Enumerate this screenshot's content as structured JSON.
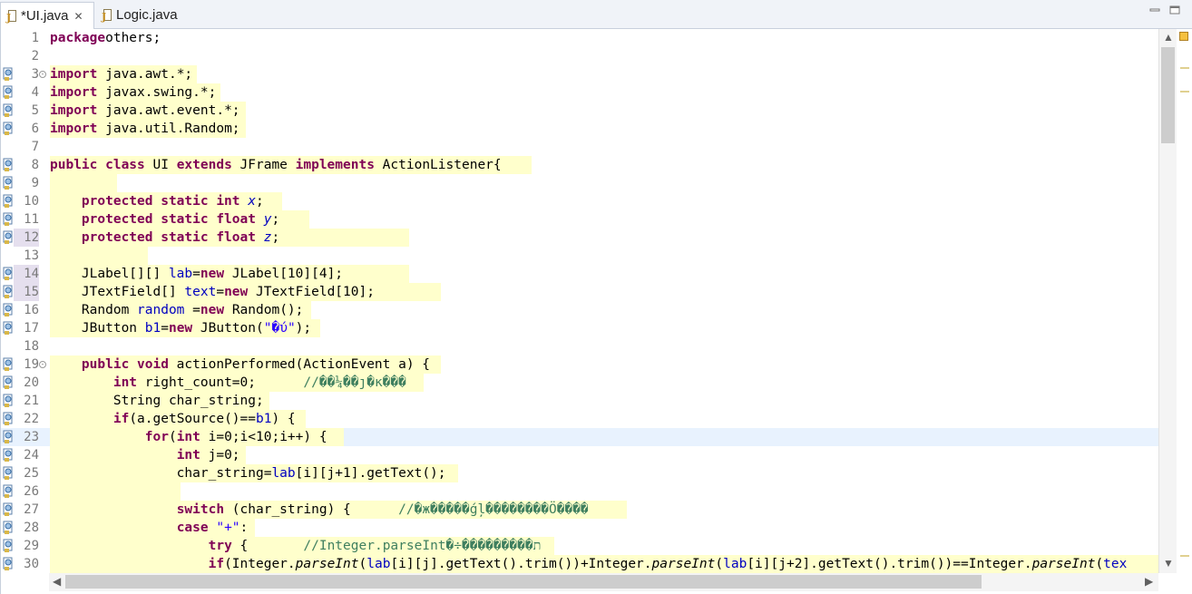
{
  "tabs": [
    {
      "label": "*UI.java",
      "close": "✕"
    },
    {
      "label": "Logic.java"
    }
  ],
  "window_controls": {
    "minimize": "minimize-icon",
    "maximize": "maximize-icon"
  },
  "lines": [
    {
      "n": "1",
      "segs": [
        [
          "kw",
          "package"
        ],
        [
          "",
          "others;"
        ]
      ]
    },
    {
      "n": "2",
      "segs": []
    },
    {
      "n": "3",
      "fold": "⊖",
      "segs": [
        [
          "kw",
          "import"
        ],
        [
          "",
          " java.awt.*;"
        ]
      ]
    },
    {
      "n": "4",
      "segs": [
        [
          "kw",
          "import"
        ],
        [
          "",
          " javax.swing.*;"
        ]
      ]
    },
    {
      "n": "5",
      "segs": [
        [
          "kw",
          "import"
        ],
        [
          "",
          " java.awt.event.*;"
        ]
      ]
    },
    {
      "n": "6",
      "segs": [
        [
          "kw",
          "import"
        ],
        [
          "",
          " java.util.Random;"
        ]
      ]
    },
    {
      "n": "7",
      "segs": []
    },
    {
      "n": "8",
      "segs": [
        [
          "kw",
          "public class"
        ],
        [
          "",
          " UI "
        ],
        [
          "kw",
          "extends"
        ],
        [
          "",
          " JFrame "
        ],
        [
          "kw",
          "implements"
        ],
        [
          "",
          " ActionListener{"
        ]
      ]
    },
    {
      "n": "9",
      "segs": []
    },
    {
      "n": "10",
      "segs": [
        [
          "",
          "    "
        ],
        [
          "kw",
          "protected static int"
        ],
        [
          "",
          " "
        ],
        [
          "sfld",
          "x"
        ],
        [
          "",
          ";"
        ]
      ]
    },
    {
      "n": "11",
      "segs": [
        [
          "",
          "    "
        ],
        [
          "kw",
          "protected static float"
        ],
        [
          "",
          " "
        ],
        [
          "sfld",
          "y"
        ],
        [
          "",
          ";"
        ]
      ]
    },
    {
      "n": "12",
      "segs": [
        [
          "",
          "    "
        ],
        [
          "kw",
          "protected static float"
        ],
        [
          "",
          " "
        ],
        [
          "sfld",
          "z"
        ],
        [
          "",
          ";"
        ]
      ]
    },
    {
      "n": "13",
      "segs": []
    },
    {
      "n": "14",
      "segs": [
        [
          "",
          "    JLabel[][] "
        ],
        [
          "fld",
          "lab"
        ],
        [
          "",
          "="
        ],
        [
          "kw",
          "new"
        ],
        [
          "",
          " JLabel[10][4];"
        ]
      ]
    },
    {
      "n": "15",
      "segs": [
        [
          "",
          "    JTextField[] "
        ],
        [
          "fld",
          "text"
        ],
        [
          "",
          "="
        ],
        [
          "kw",
          "new"
        ],
        [
          "",
          " JTextField[10];"
        ]
      ]
    },
    {
      "n": "16",
      "segs": [
        [
          "",
          "    Random "
        ],
        [
          "fld",
          "random"
        ],
        [
          "",
          " ="
        ],
        [
          "kw",
          "new"
        ],
        [
          "",
          " Random();"
        ]
      ]
    },
    {
      "n": "17",
      "segs": [
        [
          "",
          "    JButton "
        ],
        [
          "fld",
          "b1"
        ],
        [
          "",
          "="
        ],
        [
          "kw",
          "new"
        ],
        [
          "",
          " JButton("
        ],
        [
          "str",
          "\"�ύ\""
        ],
        [
          "",
          ");"
        ]
      ]
    },
    {
      "n": "18",
      "segs": []
    },
    {
      "n": "19",
      "fold": "⊖",
      "segs": [
        [
          "",
          "    "
        ],
        [
          "kw",
          "public void"
        ],
        [
          "",
          " actionPerformed(ActionEvent a) {"
        ]
      ]
    },
    {
      "n": "20",
      "segs": [
        [
          "",
          "        "
        ],
        [
          "kw",
          "int"
        ],
        [
          "",
          " right_count=0;      "
        ],
        [
          "cmt",
          "//��¼��ȷ�ĸ���"
        ]
      ]
    },
    {
      "n": "21",
      "segs": [
        [
          "",
          "        String char_string;"
        ]
      ]
    },
    {
      "n": "22",
      "segs": [
        [
          "",
          "        "
        ],
        [
          "kw",
          "if"
        ],
        [
          "",
          "(a.getSource()=="
        ],
        [
          "fld",
          "b1"
        ],
        [
          "",
          ") {"
        ]
      ]
    },
    {
      "n": "23",
      "segs": [
        [
          "",
          "            "
        ],
        [
          "kw",
          "for"
        ],
        [
          "",
          "("
        ],
        [
          "kw",
          "int"
        ],
        [
          "",
          " i=0;i<10;i++) {"
        ]
      ]
    },
    {
      "n": "24",
      "segs": [
        [
          "",
          "                "
        ],
        [
          "kw",
          "int"
        ],
        [
          "",
          " j=0;"
        ]
      ]
    },
    {
      "n": "25",
      "segs": [
        [
          "",
          "                char_string="
        ],
        [
          "fld",
          "lab"
        ],
        [
          "",
          "[i][j+1].getText();"
        ]
      ]
    },
    {
      "n": "26",
      "segs": []
    },
    {
      "n": "27",
      "segs": [
        [
          "",
          "                "
        ],
        [
          "kw",
          "switch"
        ],
        [
          "",
          " (char_string) {      "
        ],
        [
          "cmt",
          "//�ж�����ǵļ��������Ö����"
        ]
      ]
    },
    {
      "n": "28",
      "segs": [
        [
          "",
          "                "
        ],
        [
          "kw",
          "case"
        ],
        [
          "",
          " "
        ],
        [
          "str",
          "\"+\""
        ],
        [
          "",
          ":"
        ]
      ]
    },
    {
      "n": "29",
      "segs": [
        [
          "",
          "                    "
        ],
        [
          "kw",
          "try"
        ],
        [
          "",
          " {       "
        ],
        [
          "cmt",
          "//Integer.parseInt�÷���������ת"
        ]
      ]
    },
    {
      "n": "30",
      "segs": [
        [
          "",
          "                    "
        ],
        [
          "kw",
          "if"
        ],
        [
          "",
          "(Integer."
        ],
        [
          "sm",
          "parseInt"
        ],
        [
          "",
          "("
        ],
        [
          "fld",
          "lab"
        ],
        [
          "",
          "[i][j].getText().trim())+Integer."
        ],
        [
          "sm",
          "parseInt"
        ],
        [
          "",
          "("
        ],
        [
          "fld",
          "lab"
        ],
        [
          "",
          "[i][j+2].getText().trim())==Integer."
        ],
        [
          "sm",
          "parseInt"
        ],
        [
          "",
          "("
        ],
        [
          "fld",
          "tex"
        ]
      ]
    }
  ]
}
